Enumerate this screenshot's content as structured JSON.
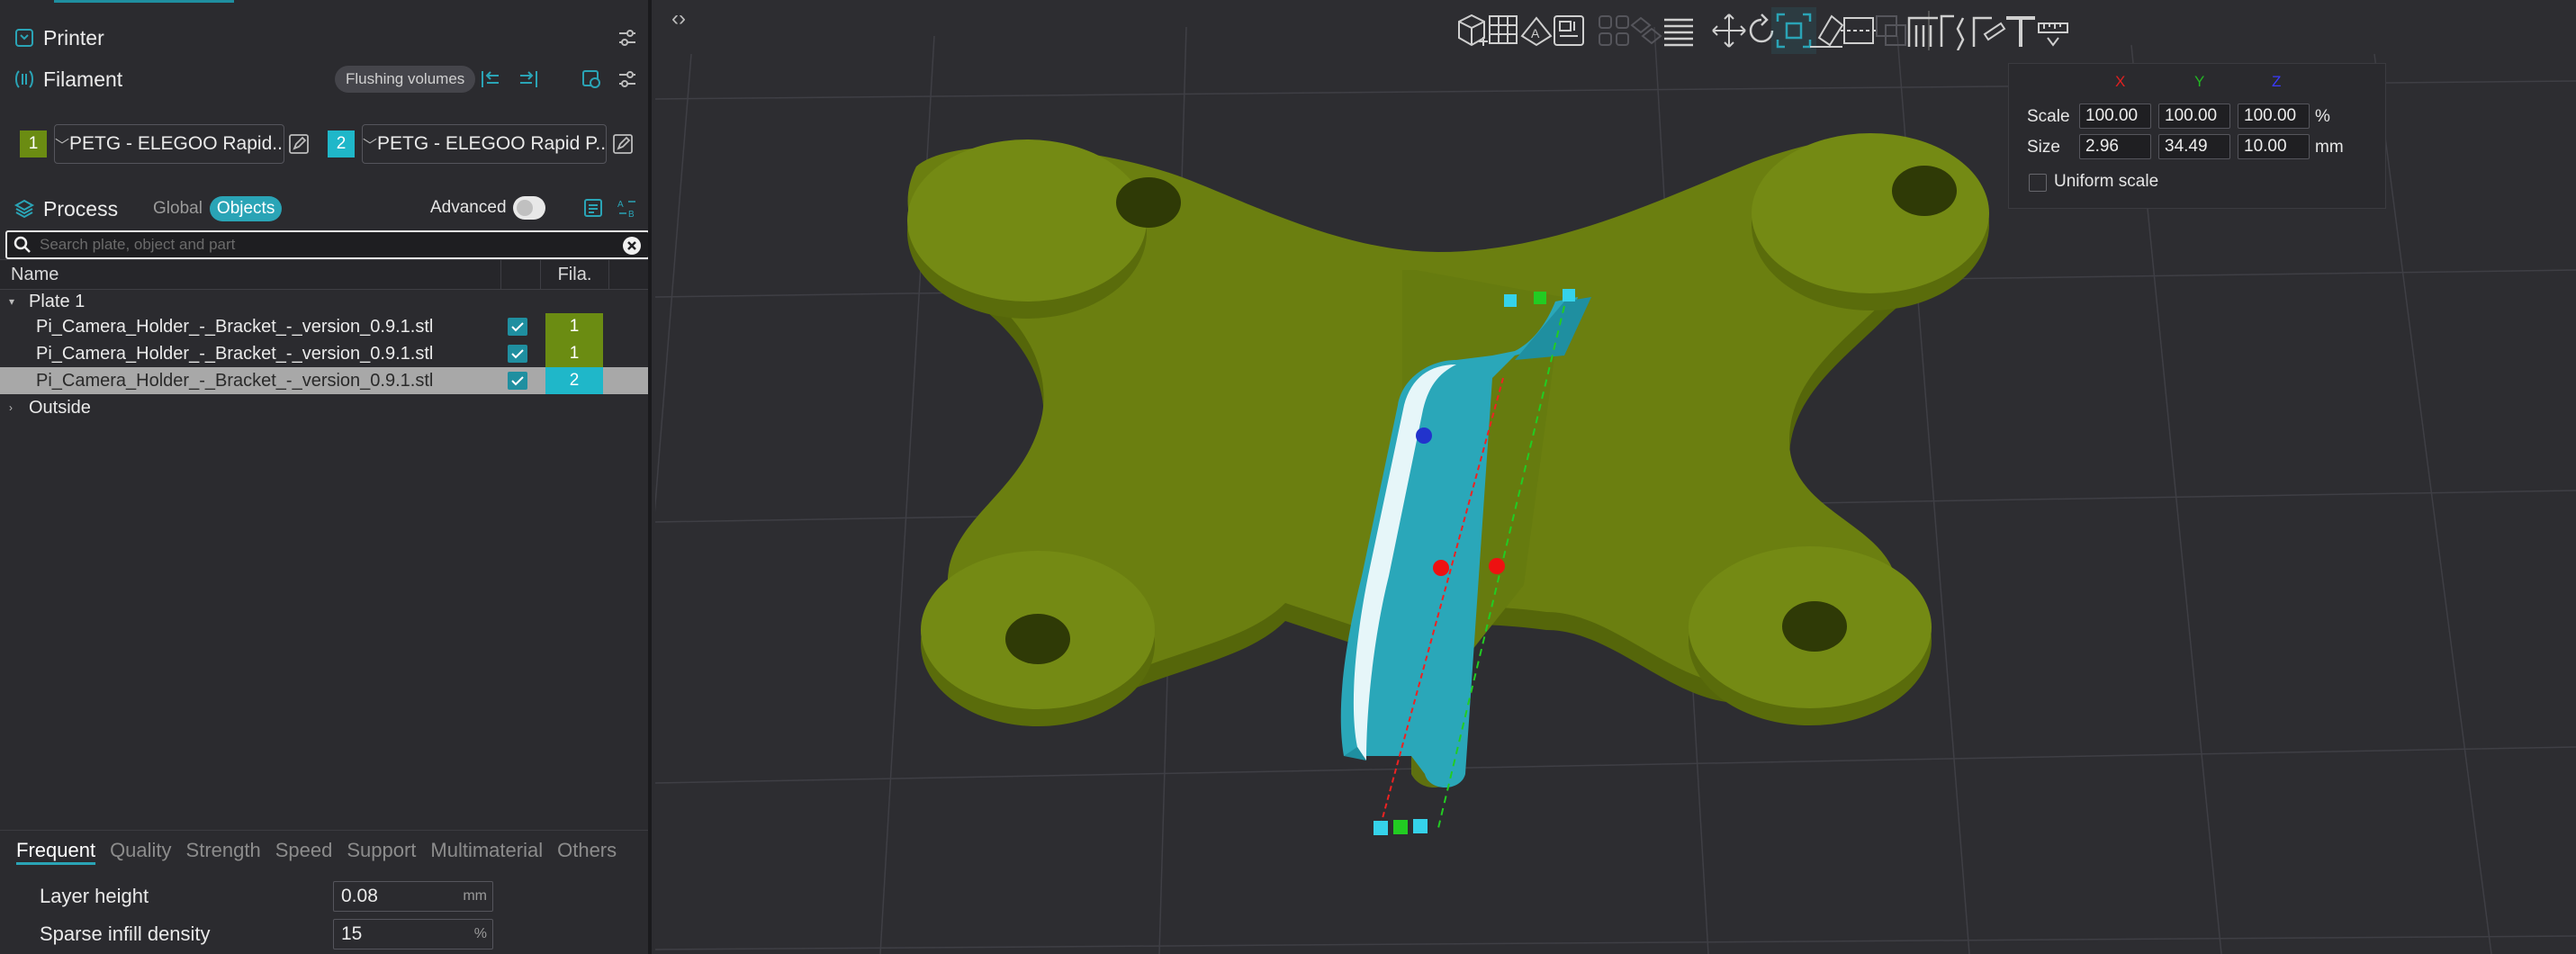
{
  "printer": {
    "title": "Printer"
  },
  "filament": {
    "title": "Filament",
    "flushing_label": "Flushing volumes",
    "slots": [
      {
        "num": "1",
        "name": "PETG - ELEGOO Rapid...",
        "color": "#6b8c12"
      },
      {
        "num": "2",
        "name": "PETG - ELEGOO Rapid P...",
        "color": "#1fb7c9"
      }
    ]
  },
  "process": {
    "title": "Process",
    "global_label": "Global",
    "objects_label": "Objects",
    "advanced_label": "Advanced",
    "advanced_on": false
  },
  "search": {
    "placeholder": "Search plate, object and part",
    "value": ""
  },
  "object_list": {
    "col_name": "Name",
    "col_fila": "Fila.",
    "plate_label": "Plate 1",
    "items": [
      {
        "name": "Pi_Camera_Holder_-_Bracket_-_version_0.9.1.stl",
        "fila": "1",
        "color": "#6b8c12",
        "selected": false
      },
      {
        "name": "Pi_Camera_Holder_-_Bracket_-_version_0.9.1.stl",
        "fila": "1",
        "color": "#6b8c12",
        "selected": false
      },
      {
        "name": "Pi_Camera_Holder_-_Bracket_-_version_0.9.1.stl",
        "fila": "2",
        "color": "#1fb7c9",
        "selected": true
      }
    ],
    "outside_label": "Outside"
  },
  "settings_tabs": [
    "Frequent",
    "Quality",
    "Strength",
    "Speed",
    "Support",
    "Multimaterial",
    "Others"
  ],
  "active_tab": "Frequent",
  "settings": [
    {
      "label": "Layer height",
      "value": "0.08",
      "unit": "mm"
    },
    {
      "label": "Sparse infill density",
      "value": "15",
      "unit": "%"
    }
  ],
  "scale_panel": {
    "axes": [
      "X",
      "Y",
      "Z"
    ],
    "axis_colors": [
      "#e02020",
      "#22b622",
      "#3a3aff"
    ],
    "scale_label": "Scale",
    "scale": [
      "100.00",
      "100.00",
      "100.00"
    ],
    "scale_unit": "%",
    "size_label": "Size",
    "size": [
      "2.96",
      "34.49",
      "10.00"
    ],
    "size_unit": "mm",
    "uniform_label": "Uniform scale",
    "uniform_checked": false
  },
  "toolbar_icons": [
    "add-cube-icon",
    "arrange-grid-icon",
    "auto-orient-icon",
    "plate-layout-icon",
    "split-objects-icon",
    "split-parts-icon",
    "layers-list-icon",
    "move-icon",
    "rotate-icon",
    "scale-icon",
    "lay-on-face-icon",
    "cut-icon",
    "boolean-icon",
    "support-paint-icon",
    "seam-paint-icon",
    "color-paint-icon",
    "text-icon",
    "measure-icon"
  ],
  "colors": {
    "filament_1": "#6b8c12",
    "filament_2": "#1fb7c9",
    "accent": "#2aa4b6"
  }
}
